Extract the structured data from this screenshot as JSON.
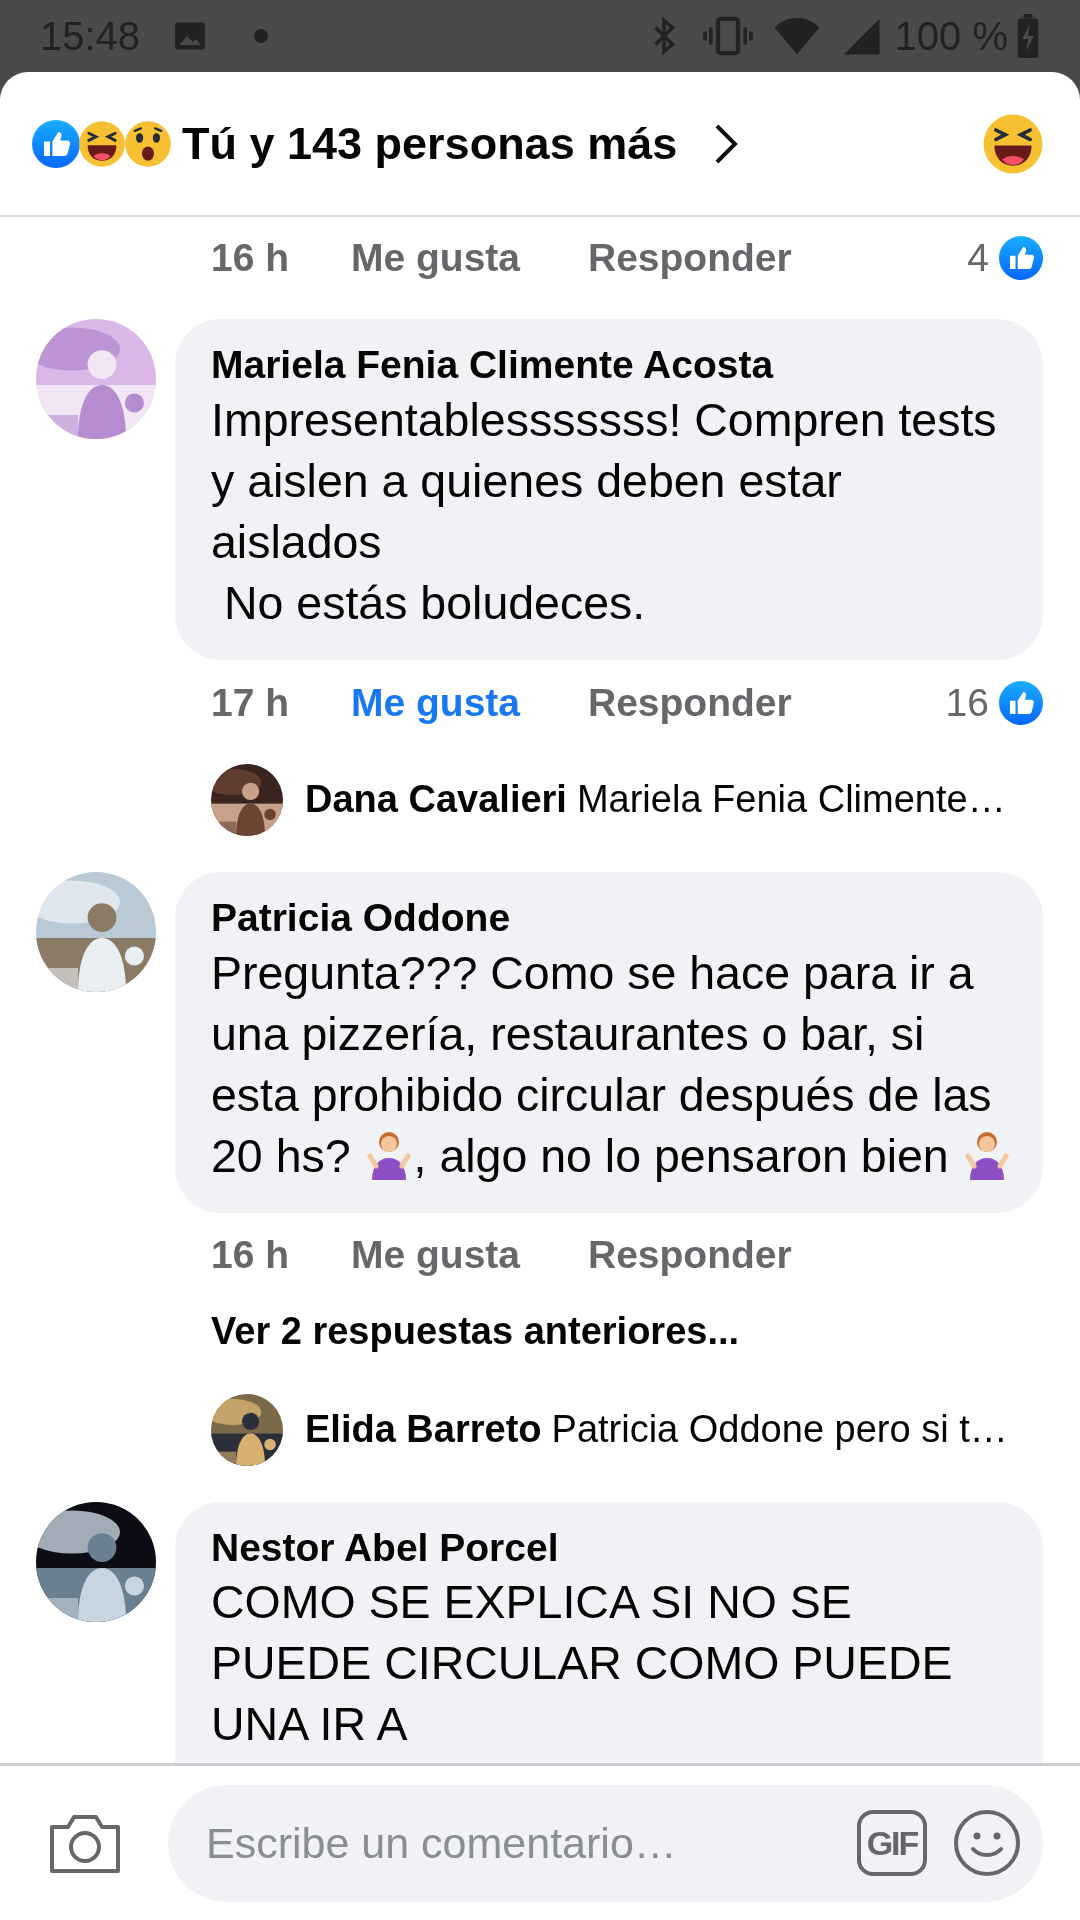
{
  "status_bar": {
    "time": "15:48",
    "battery": "100 %"
  },
  "header": {
    "title": "Tú y 143 personas más"
  },
  "feed": [
    {
      "kind": "actions",
      "time": "16 h",
      "like": "Me gusta",
      "liked": false,
      "reply": "Responder",
      "count": "4"
    },
    {
      "kind": "comment",
      "author": "Mariela Fenia Climente Acosta",
      "body": [
        {
          "kind": "text",
          "text": "Impresentablesssssss! Compren tests y aislen a quienes deben estar aislados\n No estás boludeces."
        }
      ]
    },
    {
      "kind": "actions",
      "time": "17 h",
      "like": "Me gusta",
      "liked": true,
      "reply": "Responder",
      "count": "16"
    },
    {
      "kind": "reply",
      "author": "Dana Cavalieri",
      "text": "Mariela Fenia Climente…"
    },
    {
      "kind": "comment",
      "author": "Patricia Oddone",
      "body": [
        {
          "kind": "text",
          "text": "Pregunta??? Como se hace para ir a una pizzería, restaurantes o bar, si esta prohibido circular después de las 20 hs? "
        },
        {
          "kind": "emoji"
        },
        {
          "kind": "text",
          "text": ", algo no lo pensaron bien "
        },
        {
          "kind": "emoji"
        }
      ]
    },
    {
      "kind": "actions",
      "time": "16 h",
      "like": "Me gusta",
      "liked": false,
      "reply": "Responder"
    },
    {
      "kind": "more",
      "text": "Ver 2 respuestas anteriores..."
    },
    {
      "kind": "reply",
      "author": "Elida Barreto",
      "text": "Patricia Oddone pero si t…"
    },
    {
      "kind": "comment",
      "author": "Nestor Abel Porcel",
      "body": [
        {
          "kind": "text",
          "text": "COMO SE EXPLICA SI NO SE PUEDE CIRCULAR COMO PUEDE UNA IR A"
        }
      ]
    }
  ],
  "composer": {
    "placeholder": "Escribe un comentario…",
    "gif_label": "GIF"
  }
}
